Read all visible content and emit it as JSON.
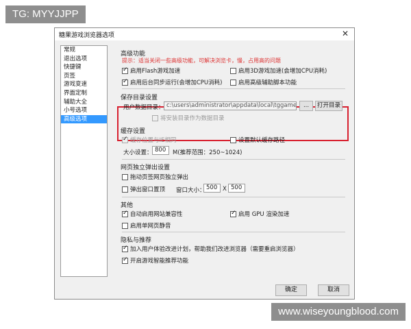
{
  "watermark_top": "TG: MYYJJPP",
  "watermark_bottom": "www.wiseyoungblood.com",
  "window": {
    "title": "糖果游戏浏览器选项",
    "close_glyph": "✕"
  },
  "nav": {
    "items": [
      {
        "label": "常规"
      },
      {
        "label": "退出选项"
      },
      {
        "label": "快捷键"
      },
      {
        "label": "页签"
      },
      {
        "label": "游戏变速"
      },
      {
        "label": "界面定制"
      },
      {
        "label": "辅助大全"
      },
      {
        "label": "小号选项"
      },
      {
        "label": "高级选项"
      }
    ],
    "selected": "高级选项"
  },
  "advanced": {
    "title": "高级功能",
    "hint": "提示：适当关闭一些高级功能，可解决浏览卡，慢，占用高的问题",
    "flash": {
      "label": "启用Flash游戏加速",
      "checked": true
    },
    "accel3d": {
      "label": "启用3D游戏加速(会增加CPU消耗)",
      "checked": false
    },
    "bgsync": {
      "label": "启用后台同步运行(会增加CPU消耗)",
      "checked": true
    },
    "script": {
      "label": "启用高级辅助脚本功能",
      "checked": false
    }
  },
  "save_dir": {
    "title": "保存目录设置",
    "user_dir_label": "用户数据目录：",
    "user_dir_value": "c:\\users\\administrator\\appdata\\local\\tggame",
    "browse_label": "...",
    "open_label": "打开目录",
    "install_dir": {
      "label": "将安装目录作为数据目录",
      "checked": false
    }
  },
  "cache": {
    "title": "缓存设置",
    "same_as_ie": {
      "label": "缓存位置与IE相同",
      "checked": true
    },
    "default_path": {
      "label": "设置默认缓存路径",
      "checked": false
    },
    "size_label": "大小设置：",
    "size_value": "800",
    "size_hint": "M(推荐范围：250~1024)"
  },
  "popup": {
    "title": "网页独立弹出设置",
    "drag_tab": {
      "label": "拖动页签网页独立弹出",
      "checked": false
    },
    "popup_window": {
      "label": "弹出窗口置顶",
      "checked": false
    },
    "size_label": "窗口大小：",
    "width": "500",
    "x_sep": "X",
    "height": "500"
  },
  "other": {
    "title": "其他",
    "compat": {
      "label": "自动启用网站兼容性",
      "checked": true
    },
    "gpu": {
      "label": "启用 GPU 渲染加速",
      "checked": true
    },
    "mute": {
      "label": "启用单网页静音",
      "checked": false
    }
  },
  "privacy": {
    "title": "隐私与推荐",
    "ux_plan": {
      "label": "加入用户体验改进计划，帮助我们改进浏览器（需要重启浏览器）",
      "checked": true
    },
    "recommend": {
      "label": "开启游戏智能推荐功能",
      "checked": true
    }
  },
  "buttons": {
    "ok": "确定",
    "cancel": "取消"
  }
}
